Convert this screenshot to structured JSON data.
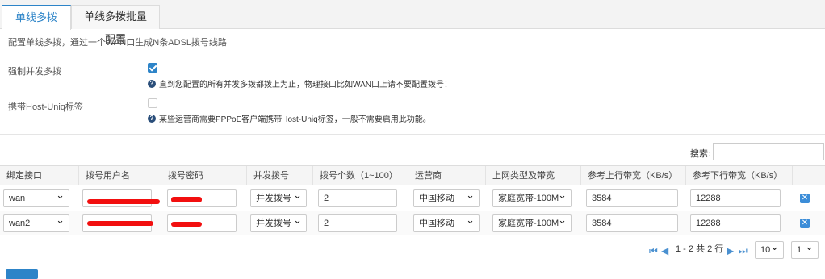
{
  "tabs": [
    {
      "label": "单线多拨",
      "active": true
    },
    {
      "label": "单线多拨批量配置",
      "active": false
    }
  ],
  "description": "配置单线多拨，通过一个WAN口生成N条ADSL拨号线路",
  "options": {
    "force_concurrent": {
      "label": "强制并发多拨",
      "checked": true,
      "help": "直到您配置的所有并发多拨都拨上为止，物理接口比如WAN口上请不要配置拨号！"
    },
    "host_uniq": {
      "label": "携带Host-Uniq标签",
      "checked": false,
      "help": "某些运营商需要PPPoE客户端携带Host-Uniq标签，一般不需要启用此功能。"
    }
  },
  "search": {
    "label": "搜索:",
    "value": ""
  },
  "table": {
    "headers": [
      "绑定接口",
      "拨号用户名",
      "拨号密码",
      "并发拨号",
      "拨号个数（1~100）",
      "运营商",
      "上网类型及带宽",
      "参考上行带宽（KB/s）",
      "参考下行带宽（KB/s）"
    ],
    "rows": [
      {
        "interface": "wan",
        "username": "",
        "password": "",
        "concurrent": "并发拨号",
        "count": "2",
        "isp": "中国移动",
        "net_type": "家庭宽带-100M",
        "up_bw": "3584",
        "down_bw": "12288"
      },
      {
        "interface": "wan2",
        "username": "",
        "password": "",
        "concurrent": "并发拨号",
        "count": "2",
        "isp": "中国移动",
        "net_type": "家庭宽带-100M",
        "up_bw": "3584",
        "down_bw": "12288"
      }
    ]
  },
  "pagination": {
    "info": "1 - 2 共 2 行",
    "page_size": "10",
    "page": "1"
  },
  "icons": {
    "help": "question-circle-icon",
    "delete": "delete-x-icon",
    "first": "first-page-icon",
    "prev": "prev-page-icon",
    "next": "next-page-icon",
    "last": "last-page-icon"
  },
  "colors": {
    "accent": "#2d84c8",
    "redaction": "#f20f0f"
  }
}
